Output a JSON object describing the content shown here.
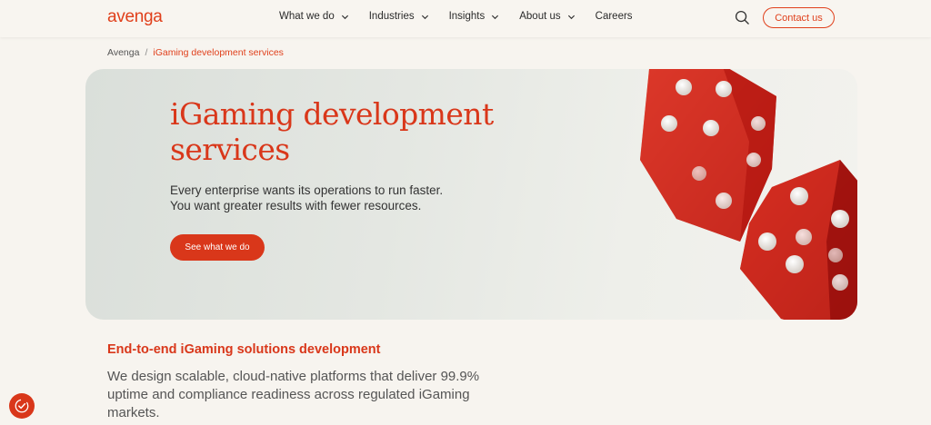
{
  "header": {
    "logo": "avenga",
    "nav": [
      {
        "label": "What we do",
        "has_dropdown": true
      },
      {
        "label": "Industries",
        "has_dropdown": true
      },
      {
        "label": "Insights",
        "has_dropdown": true
      },
      {
        "label": "About us",
        "has_dropdown": true
      },
      {
        "label": "Careers",
        "has_dropdown": false
      }
    ],
    "search_icon": "search-icon",
    "contact_label": "Contact us"
  },
  "breadcrumb": {
    "home": "Avenga",
    "separator": "/",
    "current": "iGaming development services"
  },
  "hero": {
    "title": "iGaming development services",
    "subtitle_line1": "Every enterprise wants its operations to run faster.",
    "subtitle_line2": "You want greater results with fewer resources.",
    "cta_label": "See what we do",
    "image": "red-dice-image"
  },
  "section": {
    "title": "End-to-end iGaming solutions development",
    "body": "We design scalable, cloud-native platforms that deliver 99.9% uptime and compliance readiness across regulated iGaming markets."
  },
  "accessibility_icon": "accessibility-icon",
  "colors": {
    "brand": "#e0401c",
    "background": "#f7f4ef",
    "hero_bg": "#e4e7e2"
  }
}
